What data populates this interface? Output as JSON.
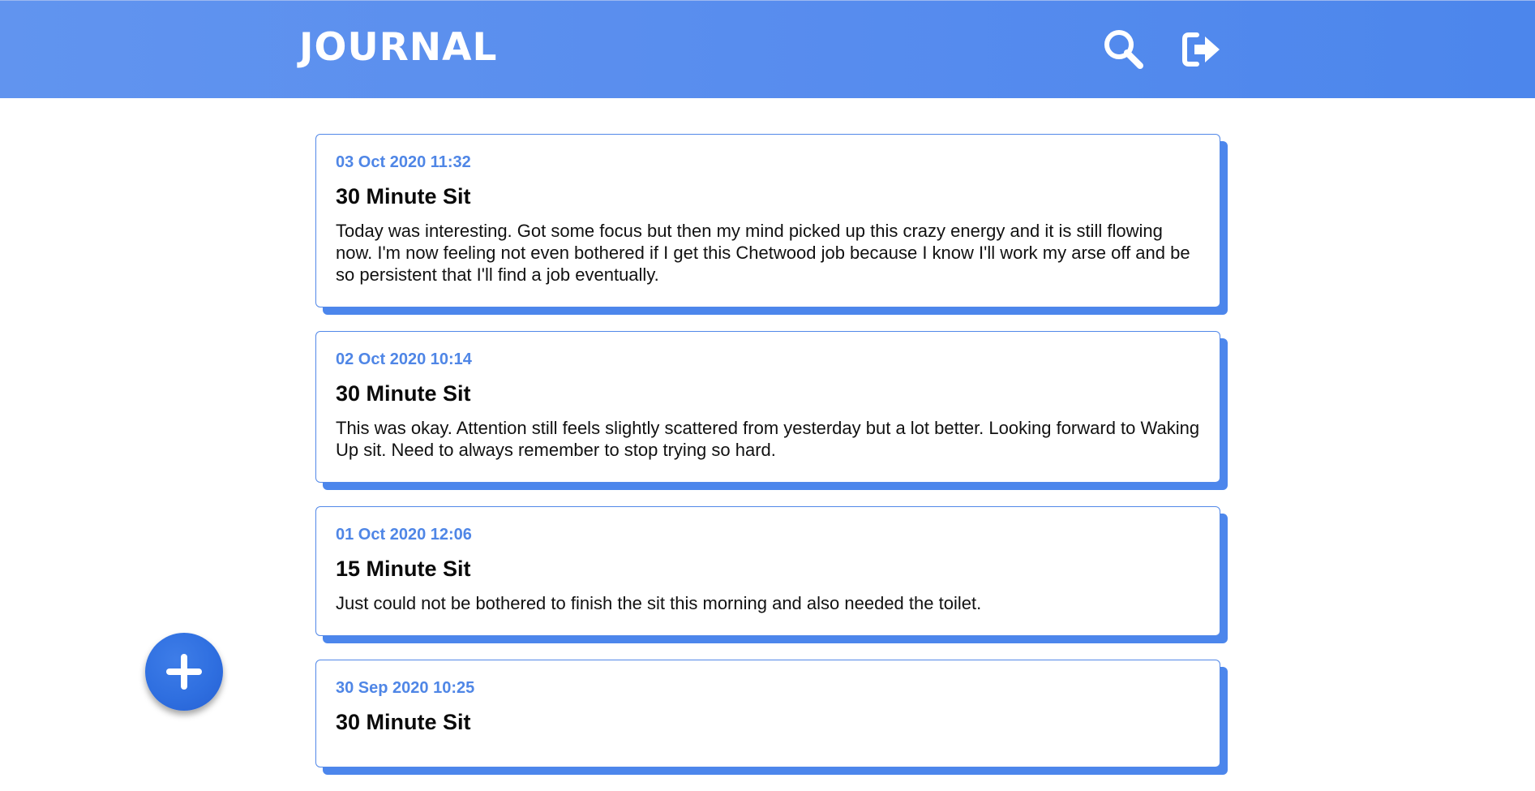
{
  "app": {
    "title": "JOURNAL",
    "accent_color": "#4c86ec",
    "date_color": "#4f86e6"
  },
  "header": {
    "search_icon": "search-icon",
    "logout_icon": "sign-out-icon"
  },
  "entries": [
    {
      "date": "03 Oct 2020 11:32",
      "title": "30 Minute Sit",
      "body": "Today was interesting. Got some focus but then my mind picked up this crazy energy and it is still flowing now. I'm now feeling not even bothered if I get this Chetwood job because I know I'll work my arse off and be so persistent that I'll find a job eventually."
    },
    {
      "date": "02 Oct 2020 10:14",
      "title": "30 Minute Sit",
      "body": "This was okay. Attention still feels slightly scattered from yesterday but a lot better. Looking forward to Waking Up sit. Need to always remember to stop trying so hard."
    },
    {
      "date": "01 Oct 2020 12:06",
      "title": "15 Minute Sit",
      "body": "Just could not be bothered to finish the sit this morning and also needed the toilet."
    },
    {
      "date": "30 Sep 2020 10:25",
      "title": "30 Minute Sit",
      "body": ""
    }
  ],
  "fab": {
    "icon": "plus-icon"
  }
}
